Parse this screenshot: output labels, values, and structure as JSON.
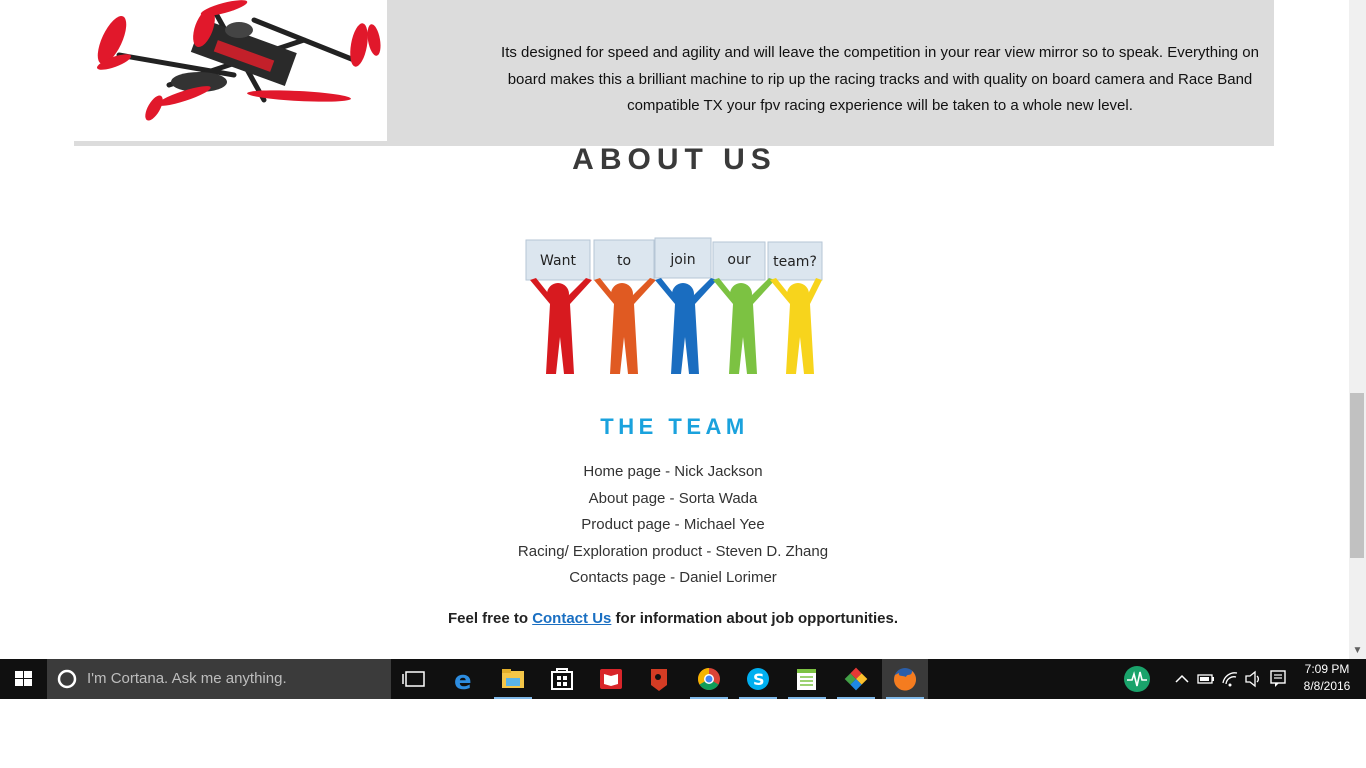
{
  "product": {
    "description": "Its designed for speed and agility and will leave the competition in your rear view mirror so to speak. Everything on board makes this a brilliant machine to rip up the racing tracks and with quality on board camera and Race Band compatible TX your fpv racing experience will be taken to a whole new level."
  },
  "about": {
    "title": "ABOUT US",
    "team_image_signs": [
      "Want",
      "to",
      "join",
      "our",
      "team?"
    ],
    "team_title": "THE TEAM",
    "team_members": [
      "Home page - Nick Jackson",
      "About page - Sorta Wada",
      "Product page - Michael Yee",
      "Racing/ Exploration product - Steven D. Zhang",
      "Contacts page - Daniel Lorimer"
    ],
    "contact_prefix": "Feel free to ",
    "contact_link": "Contact Us",
    "contact_suffix": " for information about job opportunities."
  },
  "taskbar": {
    "cortana_placeholder": "I'm Cortana. Ask me anything.",
    "apps": [
      "task-view",
      "edge",
      "file-explorer",
      "store",
      "reader",
      "ink",
      "chrome",
      "skype",
      "notepad",
      "paint-app",
      "firefox"
    ],
    "time": "7:09 PM",
    "date": "8/8/2016"
  },
  "colors": {
    "accent": "#1aa2dd",
    "link": "#1a6fc2",
    "banner": "#dcdcdc"
  }
}
